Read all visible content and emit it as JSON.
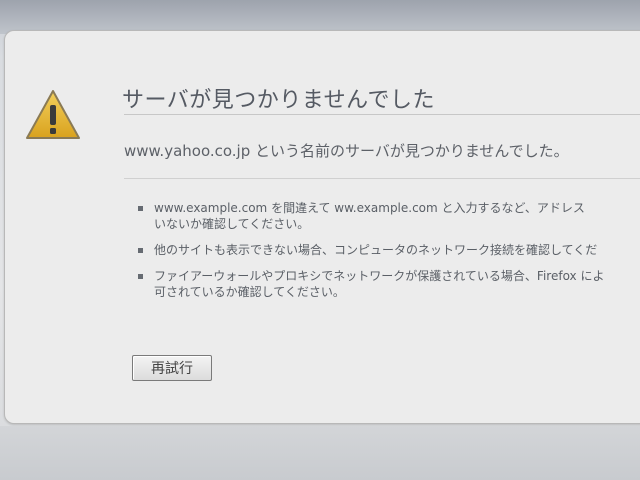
{
  "page": {
    "title": "サーバが見つかりませんでした",
    "message": "www.yahoo.co.jp という名前のサーバが見つかりませんでした。",
    "suggestions": [
      {
        "line1": "www.example.com を間違えて ww.example.com と入力するなど、アドレス",
        "line2": "いないか確認してください。"
      },
      {
        "line1": "他のサイトも表示できない場合、コンピュータのネットワーク接続を確認してくだ"
      },
      {
        "line1": "ファイアーウォールやプロキシでネットワークが保護されている場合、Firefox によ",
        "line2": "可されているか確認してください。"
      }
    ],
    "retry_label": "再試行"
  },
  "icons": {
    "warning": "warning-triangle-icon"
  },
  "colors": {
    "warning_fill": "#e6b630",
    "warning_border": "#8a7a55",
    "text": "#5d6168",
    "panel": "#ececec"
  }
}
